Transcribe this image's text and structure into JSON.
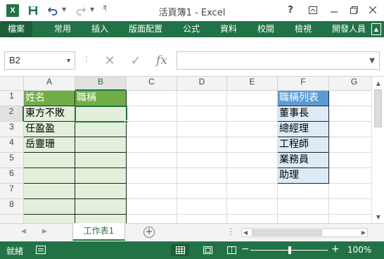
{
  "app": {
    "logo_text": "X",
    "title": "活頁簿1 - Excel"
  },
  "quick_access": {
    "save_icon": "save-icon",
    "undo_icon": "undo-icon",
    "redo_icon": "redo-icon",
    "customize_icon": "customize-icon"
  },
  "window_controls": {
    "help": "?",
    "ribbon_display_icon": "ribbon-display-icon",
    "minimize_icon": "minimize-icon",
    "restore_icon": "restore-icon",
    "close_icon": "close-icon"
  },
  "ribbon": {
    "tabs": [
      "檔案",
      "常用",
      "插入",
      "版面配置",
      "公式",
      "資料",
      "校閱",
      "檢視",
      "開發人員"
    ]
  },
  "formula_bar": {
    "name_box": "B2",
    "formula": "",
    "fx_label": "fx"
  },
  "grid": {
    "columns": [
      "A",
      "B",
      "C",
      "D",
      "E",
      "F",
      "G"
    ],
    "rows": [
      "1",
      "2",
      "3",
      "4",
      "5",
      "6",
      "7",
      "8"
    ],
    "selected_cell": "B2",
    "cells": {
      "A1": "姓名",
      "B1": "職稱",
      "A2": "東方不敗",
      "A3": "任盈盈",
      "A4": "岳靈珊",
      "F1": "職稱列表",
      "F2": "董事長",
      "F3": "總經理",
      "F4": "工程師",
      "F5": "業務員",
      "F6": "助理"
    }
  },
  "sheets": {
    "tabs": [
      "工作表1"
    ],
    "active": "工作表1"
  },
  "status": {
    "ready": "就緒",
    "zoom": "100%",
    "zoom_level": 1.0
  },
  "colors": {
    "accent": "#217346",
    "header_green": "#70ad47",
    "light_green": "#e2efda",
    "header_blue": "#5b9bd5",
    "light_blue": "#ddebf7"
  }
}
